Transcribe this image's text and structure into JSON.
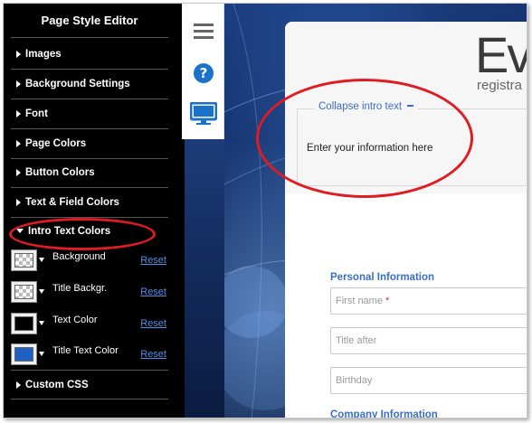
{
  "sidebar": {
    "title": "Page Style Editor",
    "items": [
      {
        "label": "Images",
        "expanded": false
      },
      {
        "label": "Background Settings",
        "expanded": false
      },
      {
        "label": "Font",
        "expanded": false
      },
      {
        "label": "Page Colors",
        "expanded": false
      },
      {
        "label": "Button Colors",
        "expanded": false
      },
      {
        "label": "Text & Field Colors",
        "expanded": false
      },
      {
        "label": "Intro Text Colors",
        "expanded": true
      },
      {
        "label": "Custom CSS",
        "expanded": false
      }
    ],
    "intro_text_colors": [
      {
        "label": "Background",
        "swatch": "transparent",
        "reset": "Reset"
      },
      {
        "label": "Title Backgr.",
        "swatch": "transparent",
        "reset": "Reset"
      },
      {
        "label": "Text Color",
        "swatch": "#000000",
        "reset": "Reset"
      },
      {
        "label": "Title Text Color",
        "swatch": "#1f5fbf",
        "reset": "Reset"
      }
    ]
  },
  "toolbar": {
    "icons": [
      "menu-icon",
      "help-icon",
      "desktop-icon"
    ]
  },
  "form": {
    "logo_text": "Ev",
    "logo_subtext": "registra",
    "intro": {
      "toggle_label": "Collapse intro text",
      "text": "Enter your information here"
    },
    "personal_section_title": "Personal Information",
    "fields": [
      {
        "placeholder": "First name",
        "required": "*"
      },
      {
        "placeholder": "Title after",
        "required": ""
      },
      {
        "placeholder": "Birthday",
        "required": ""
      }
    ],
    "company_section_title": "Company Information"
  },
  "colors": {
    "accent": "#3a6fc4",
    "annotation": "#e01b22",
    "sidebar_bg": "#000000"
  }
}
